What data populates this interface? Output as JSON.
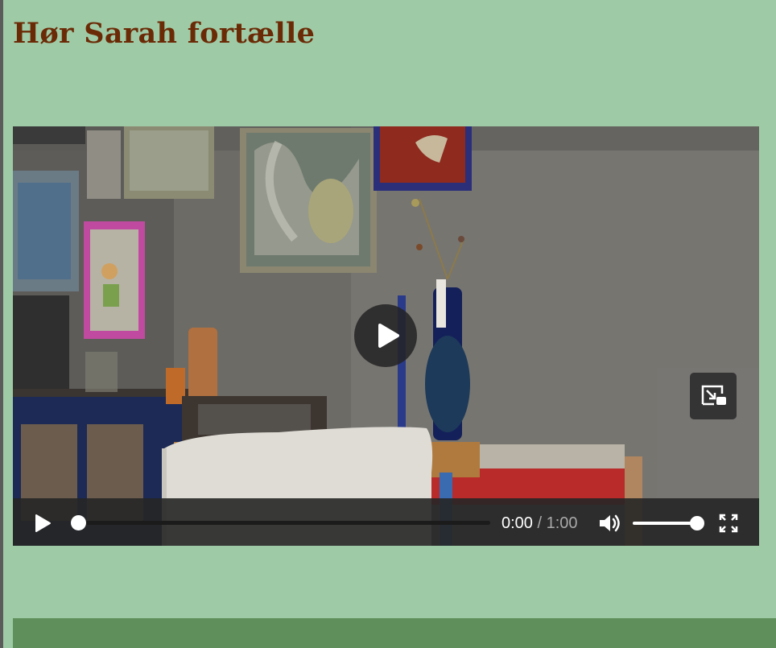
{
  "page": {
    "title": "Hør Sarah fortælle"
  },
  "video": {
    "current_time": "0:00",
    "time_separator": "/",
    "duration": "1:00",
    "progress_fraction": 0,
    "volume_fraction": 1
  },
  "icons": {
    "big_play": "play-icon",
    "pip": "picture-in-picture-icon",
    "control_play": "play-icon",
    "volume": "volume-icon",
    "fullscreen": "fullscreen-icon"
  },
  "colors": {
    "page_background": "#9ecba6",
    "title": "#6b2a06",
    "footer_band": "#5f8f5a",
    "control_bar": "#262626"
  }
}
